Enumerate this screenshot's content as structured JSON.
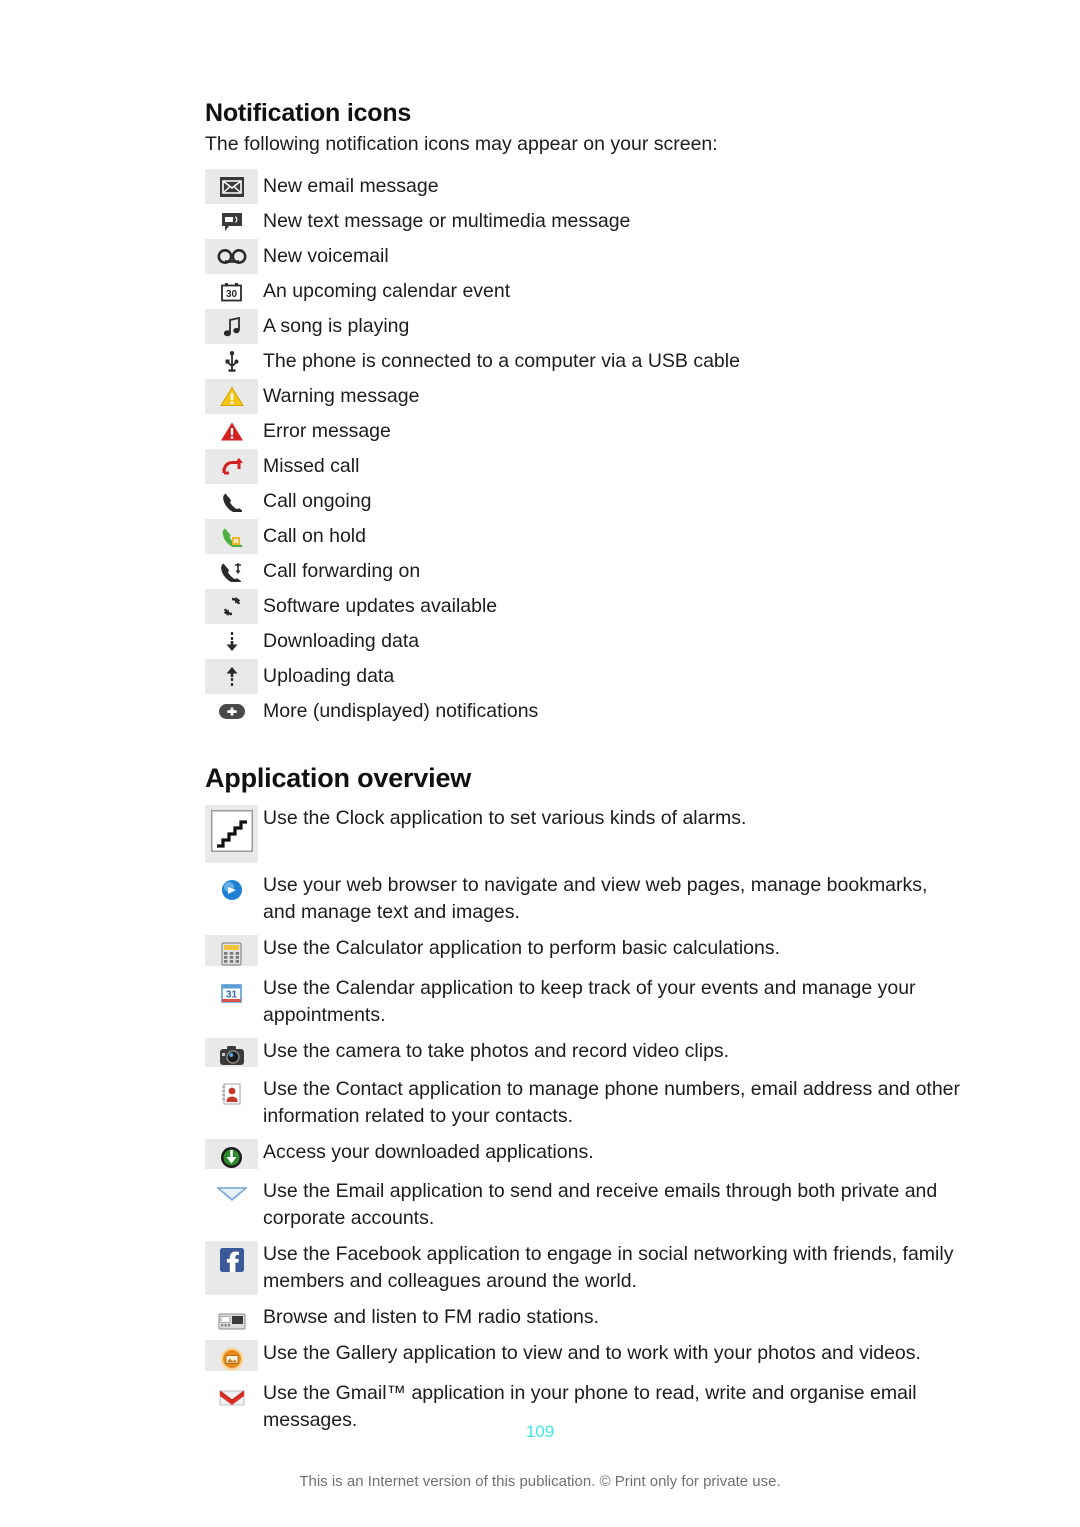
{
  "document": {
    "page_number": "109",
    "footer_note": "This is an Internet version of this publication. © Print only for private use."
  },
  "notification_section": {
    "heading": "Notification icons",
    "intro": "The following notification icons may appear on your screen:",
    "items": [
      {
        "icon": "new-email-message-icon",
        "label": "New email message"
      },
      {
        "icon": "new-text-message-icon",
        "label": "New text message or multimedia message"
      },
      {
        "icon": "new-voicemail-icon",
        "label": "New voicemail"
      },
      {
        "icon": "calendar-event-icon",
        "label": "An upcoming calendar event"
      },
      {
        "icon": "music-note-icon",
        "label": "A song is playing"
      },
      {
        "icon": "usb-icon",
        "label": "The phone is connected to a computer via a USB cable"
      },
      {
        "icon": "warning-triangle-icon",
        "label": "Warning message"
      },
      {
        "icon": "error-triangle-icon",
        "label": "Error message"
      },
      {
        "icon": "missed-call-icon",
        "label": "Missed call"
      },
      {
        "icon": "call-ongoing-icon",
        "label": "Call ongoing"
      },
      {
        "icon": "call-on-hold-icon",
        "label": "Call on hold"
      },
      {
        "icon": "call-forwarding-icon",
        "label": "Call forwarding on"
      },
      {
        "icon": "software-update-icon",
        "label": "Software updates available"
      },
      {
        "icon": "download-arrow-icon",
        "label": "Downloading data"
      },
      {
        "icon": "upload-arrow-icon",
        "label": "Uploading data"
      },
      {
        "icon": "more-notifications-icon",
        "label": "More (undisplayed) notifications"
      }
    ]
  },
  "application_section": {
    "heading": "Application overview",
    "items": [
      {
        "icon": "clock-app-icon",
        "label": "Use the Clock application to set various kinds of alarms."
      },
      {
        "icon": "browser-app-icon",
        "label": "Use your web browser to navigate and view web pages, manage bookmarks, and manage text and images."
      },
      {
        "icon": "calculator-app-icon",
        "label": "Use the Calculator application to perform basic calculations."
      },
      {
        "icon": "calendar-app-icon",
        "label": "Use the Calendar application to keep track of your events and manage your appointments."
      },
      {
        "icon": "camera-app-icon",
        "label": "Use the camera to take photos and record video clips."
      },
      {
        "icon": "contacts-app-icon",
        "label": "Use the Contact application to manage phone numbers, email address and other information related to your contacts."
      },
      {
        "icon": "downloads-app-icon",
        "label": "Access your downloaded applications."
      },
      {
        "icon": "email-app-icon",
        "label": "Use the Email application to send and receive emails through both private and corporate accounts."
      },
      {
        "icon": "facebook-app-icon",
        "label": "Use the Facebook application to engage in social networking with friends, family members and colleagues around the world."
      },
      {
        "icon": "fm-radio-app-icon",
        "label": "Browse and listen to FM radio stations."
      },
      {
        "icon": "gallery-app-icon",
        "label": "Use the Gallery application to view and to work with your photos and videos."
      },
      {
        "icon": "gmail-app-icon",
        "label": "Use the Gmail™ application in your phone to read, write and organise email messages."
      }
    ]
  },
  "colors": {
    "cell_shade": "#e9e9e9",
    "page_number": "#3fe9e2",
    "warning": "#f5c518",
    "error": "#d32020",
    "missed_call": "#d32020",
    "call_hold_green": "#4caf3f",
    "facebook_blue": "#3b5998",
    "gallery_orange": "#e8881a",
    "downloads_green": "#2f8a2f",
    "browser_blue": "#1f7fd0",
    "gmail_red": "#d93025",
    "text": "#1d1d1d",
    "footer": "#707070"
  }
}
